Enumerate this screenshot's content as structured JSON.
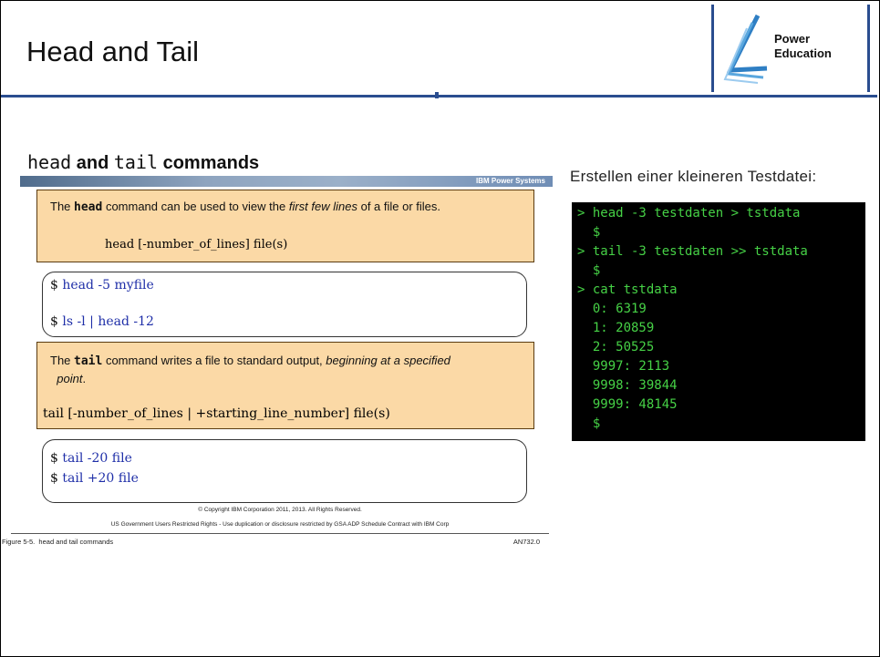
{
  "title": "Head and Tail",
  "logo": {
    "line1": "Power",
    "line2": "Education"
  },
  "slide": {
    "heading_head": "head",
    "heading_and": " and ",
    "heading_tail": "tail",
    "heading_commands": " commands",
    "banner": "IBM Power Systems",
    "head_desc_pre": "The ",
    "head_desc_cmd": "head",
    "head_desc_mid": " command can be used to view the ",
    "head_desc_em": "first few lines",
    "head_desc_post": " of a file or files.",
    "head_syntax": "head [-number_of_lines] file(s)",
    "head_ex": [
      {
        "prompt": "$",
        "cmd": "head -5 myfile"
      },
      {
        "prompt": "$",
        "cmd": "ls -l | head -12"
      }
    ],
    "tail_desc_pre": "The ",
    "tail_desc_cmd": "tail",
    "tail_desc_mid": " command writes a file to standard output, ",
    "tail_desc_em": "beginning at a specified",
    "tail_desc_em2": "point",
    "tail_desc_post": ".",
    "tail_syntax": "tail [-number_of_lines | +starting_line_number] file(s)",
    "tail_ex": [
      {
        "prompt": "$",
        "cmd": "tail -20 file"
      },
      {
        "prompt": "$",
        "cmd": "tail +20 file"
      }
    ],
    "copyright": "© Copyright IBM Corporation 2011, 2013. All Rights Reserved.",
    "restricted": "US Government Users Restricted Rights - Use duplication or disclosure restricted by GSA ADP Schedule Contract with IBM Corp",
    "figure": "Figure 5-5.  head and tail commands",
    "code": "AN732.0"
  },
  "right_label": "Erstellen einer kleineren Testdatei:",
  "terminal": [
    "> head -3 testdaten > tstdata",
    "  $",
    "> tail -3 testdaten >> tstdata",
    "  $",
    "> cat tstdata",
    "  0: 6319",
    "  1: 20859",
    "  2: 50525",
    "  9997: 2113",
    "  9998: 39844",
    "  9999: 48145",
    "  $"
  ]
}
